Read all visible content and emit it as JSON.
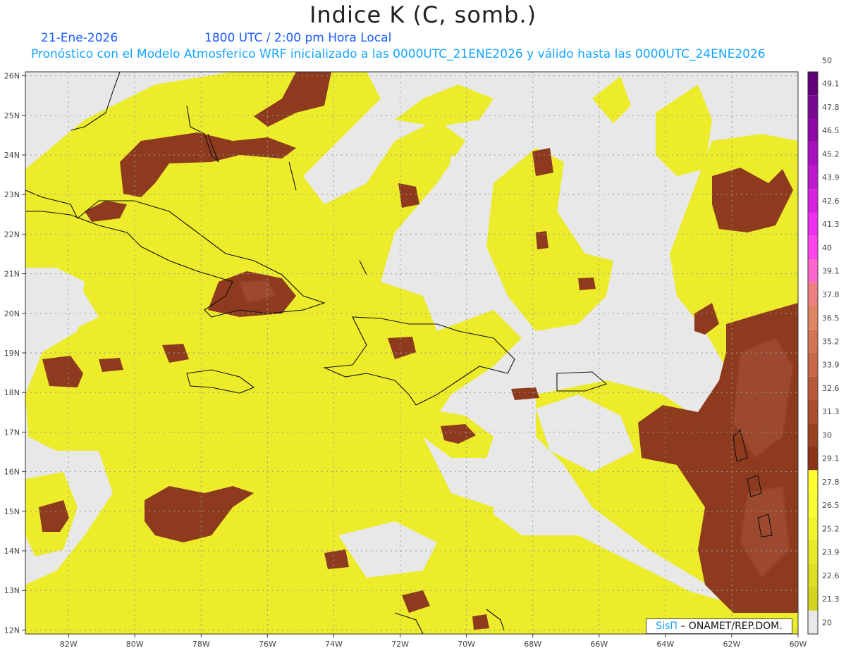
{
  "header": {
    "title": "Indice K (C, somb.)",
    "date": "21-Ene-2026",
    "time": "1800 UTC / 2:00 pm Hora Local",
    "description": "Pronóstico con el Modelo Atmosferico WRF inicializado a las 0000UTC_21ENE2026 y válido hasta las  0000UTC_24ENE2026"
  },
  "map": {
    "lon_range": [
      -83.3,
      -60
    ],
    "lat_range": [
      11.9,
      26.1
    ],
    "lon_ticks": [
      "82W",
      "80W",
      "78W",
      "76W",
      "74W",
      "72W",
      "70W",
      "68W",
      "66W",
      "64W",
      "62W",
      "60W"
    ],
    "lat_ticks": [
      "12N",
      "13N",
      "14N",
      "15N",
      "16N",
      "17N",
      "18N",
      "19N",
      "20N",
      "21N",
      "22N",
      "23N",
      "24N",
      "25N",
      "26N"
    ],
    "background_color": "#e8e8e8",
    "grid": "dotted"
  },
  "colorbar": {
    "labels": [
      "20",
      "21.3",
      "22.6",
      "23.9",
      "25.2",
      "26.5",
      "27.8",
      "29.1",
      "30",
      "31.3",
      "32.6",
      "33.9",
      "35.2",
      "36.5",
      "37.8",
      "39.1",
      "40",
      "41.3",
      "42.6",
      "43.9",
      "45.2",
      "46.5",
      "47.8",
      "49.1",
      "50"
    ],
    "colors": [
      "#e8e8e8",
      "#c8c81a",
      "#d4d41f",
      "#dede24",
      "#e8e829",
      "#f2f22e",
      "#fbfb33",
      "#ffff30",
      "#8b3418",
      "#9b4022",
      "#ab4c2e",
      "#bb5a3a",
      "#c86848",
      "#d47656",
      "#e08466",
      "#f08080",
      "#ff66cc",
      "#ff44ee",
      "#f030f0",
      "#d820e0",
      "#c018d0",
      "#a810c0",
      "#9008a8",
      "#780890",
      "#600078"
    ]
  },
  "credit": {
    "brand": "SisΠ",
    "text": "– ONAMET/REP.DOM."
  }
}
